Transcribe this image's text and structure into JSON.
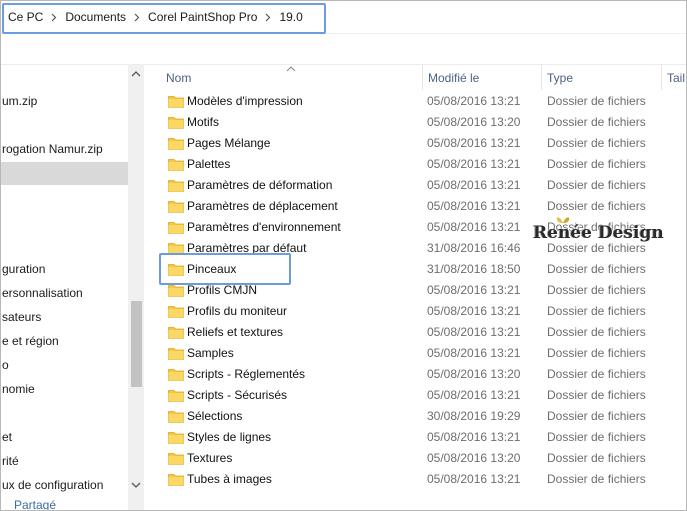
{
  "address": {
    "crumbs": [
      "Ce PC",
      "Documents",
      "Corel PaintShop Pro",
      "19.0"
    ]
  },
  "nav": {
    "items": [
      {
        "label": "um.zip"
      },
      {
        "label": "rogation Namur.zip"
      },
      {
        "label": "guration"
      },
      {
        "label": "ersonnalisation"
      },
      {
        "label": "sateurs"
      },
      {
        "label": "e et région"
      },
      {
        "label": "o"
      },
      {
        "label": "nomie"
      },
      {
        "label": "et"
      },
      {
        "label": "rité"
      },
      {
        "label": "ux de configuration"
      },
      {
        "label": "Partagé"
      }
    ]
  },
  "columns": {
    "name": "Nom",
    "modified": "Modifié le",
    "type": "Type",
    "size": "Tail"
  },
  "rows": [
    {
      "name": "Modèles d'impression",
      "date": "05/08/2016 13:21",
      "type": "Dossier de fichiers"
    },
    {
      "name": "Motifs",
      "date": "05/08/2016 13:20",
      "type": "Dossier de fichiers"
    },
    {
      "name": "Pages Mélange",
      "date": "05/08/2016 13:21",
      "type": "Dossier de fichiers"
    },
    {
      "name": "Palettes",
      "date": "05/08/2016 13:21",
      "type": "Dossier de fichiers"
    },
    {
      "name": "Paramètres de déformation",
      "date": "05/08/2016 13:21",
      "type": "Dossier de fichiers"
    },
    {
      "name": "Paramètres de déplacement",
      "date": "05/08/2016 13:21",
      "type": "Dossier de fichiers"
    },
    {
      "name": "Paramètres d'environnement",
      "date": "05/08/2016 13:21",
      "type": "Dossier de fichiers"
    },
    {
      "name": "Paramètres par défaut",
      "date": "31/08/2016 16:46",
      "type": "Dossier de fichiers"
    },
    {
      "name": "Pinceaux",
      "date": "31/08/2016 18:50",
      "type": "Dossier de fichiers"
    },
    {
      "name": "Profils CMJN",
      "date": "05/08/2016 13:21",
      "type": "Dossier de fichiers"
    },
    {
      "name": "Profils du moniteur",
      "date": "05/08/2016 13:21",
      "type": "Dossier de fichiers"
    },
    {
      "name": "Reliefs et textures",
      "date": "05/08/2016 13:21",
      "type": "Dossier de fichiers"
    },
    {
      "name": "Samples",
      "date": "05/08/2016 13:21",
      "type": "Dossier de fichiers"
    },
    {
      "name": "Scripts - Réglementés",
      "date": "05/08/2016 13:20",
      "type": "Dossier de fichiers"
    },
    {
      "name": "Scripts - Sécurisés",
      "date": "05/08/2016 13:21",
      "type": "Dossier de fichiers"
    },
    {
      "name": "Sélections",
      "date": "30/08/2016 19:29",
      "type": "Dossier de fichiers"
    },
    {
      "name": "Styles de lignes",
      "date": "05/08/2016 13:21",
      "type": "Dossier de fichiers"
    },
    {
      "name": "Textures",
      "date": "05/08/2016 13:20",
      "type": "Dossier de fichiers"
    },
    {
      "name": "Tubes à images",
      "date": "05/08/2016 13:21",
      "type": "Dossier de fichiers"
    }
  ],
  "watermark": {
    "text": "Renée Design"
  },
  "icons": {
    "folder": "folder-icon",
    "separator": "chevron-right-icon",
    "sort": "sort-ascending-icon"
  },
  "colors": {
    "highlight_box": "#6b9cdc",
    "folder_fill": "#f5c842",
    "header_text": "#4d6185",
    "meta_text": "#6d6d6d",
    "nav_selected": "#d9d9d9"
  }
}
